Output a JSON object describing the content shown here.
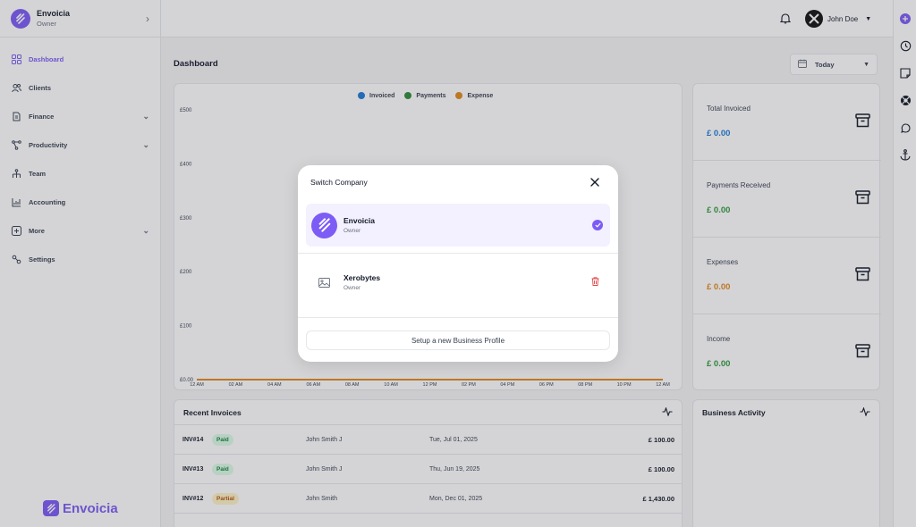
{
  "sidebar": {
    "company_name": "Envoicia",
    "company_role": "Owner",
    "nav": [
      {
        "label": "Dashboard"
      },
      {
        "label": "Clients"
      },
      {
        "label": "Finance"
      },
      {
        "label": "Productivity"
      },
      {
        "label": "Team"
      },
      {
        "label": "Accounting"
      },
      {
        "label": "More"
      },
      {
        "label": "Settings"
      }
    ],
    "brand": "Envoicia"
  },
  "topbar": {
    "user_name": "John Doe"
  },
  "main": {
    "title": "Dashboard",
    "date_filter": "Today"
  },
  "chart_data": {
    "type": "line",
    "series": [
      {
        "name": "Invoiced",
        "values": [
          0,
          0,
          0,
          0,
          0,
          0,
          0,
          0,
          0,
          0,
          0,
          0,
          0
        ]
      },
      {
        "name": "Payments",
        "values": [
          0,
          0,
          0,
          0,
          0,
          0,
          0,
          0,
          0,
          0,
          0,
          0,
          0
        ]
      },
      {
        "name": "Expense",
        "values": [
          0,
          0,
          0,
          0,
          0,
          0,
          0,
          0,
          0,
          0,
          0,
          0,
          0
        ]
      }
    ],
    "colors": [
      "#1d7bd8",
      "#2e8b3a",
      "#e08a1e"
    ],
    "x": [
      "12 AM",
      "02 AM",
      "04 AM",
      "06 AM",
      "08 AM",
      "10 AM",
      "12 PM",
      "02 PM",
      "04 PM",
      "06 PM",
      "08 PM",
      "10 PM",
      "12 AM"
    ],
    "y_ticks": [
      "£0.00",
      "£100",
      "£200",
      "£300",
      "£400",
      "£500"
    ],
    "ylim": [
      0,
      500
    ],
    "legend_position": "top"
  },
  "stats": [
    {
      "label": "Total Invoiced",
      "value": "£ 0.00",
      "color": "#1d7bd8"
    },
    {
      "label": "Payments Received",
      "value": "£ 0.00",
      "color": "#2e9a3e"
    },
    {
      "label": "Expenses",
      "value": "£ 0.00",
      "color": "#e08a1e"
    },
    {
      "label": "Income",
      "value": "£ 0.00",
      "color": "#2e9a3e"
    }
  ],
  "recent_invoices": {
    "title": "Recent Invoices",
    "rows": [
      {
        "id": "INV#14",
        "status": "Paid",
        "client": "John Smith J",
        "date": "Tue, Jul 01, 2025",
        "amount": "£ 100.00"
      },
      {
        "id": "INV#13",
        "status": "Paid",
        "client": "John Smith J",
        "date": "Thu, Jun 19, 2025",
        "amount": "£ 100.00"
      },
      {
        "id": "INV#12",
        "status": "Partial",
        "client": "John Smith",
        "date": "Mon, Dec 01, 2025",
        "amount": "£ 1,430.00"
      }
    ]
  },
  "business_activity": {
    "title": "Business Activity"
  },
  "modal": {
    "title": "Switch Company",
    "companies": [
      {
        "name": "Envoicia",
        "role": "Owner"
      },
      {
        "name": "Xerobytes",
        "role": "Owner"
      }
    ],
    "setup_button": "Setup a new Business Profile"
  }
}
